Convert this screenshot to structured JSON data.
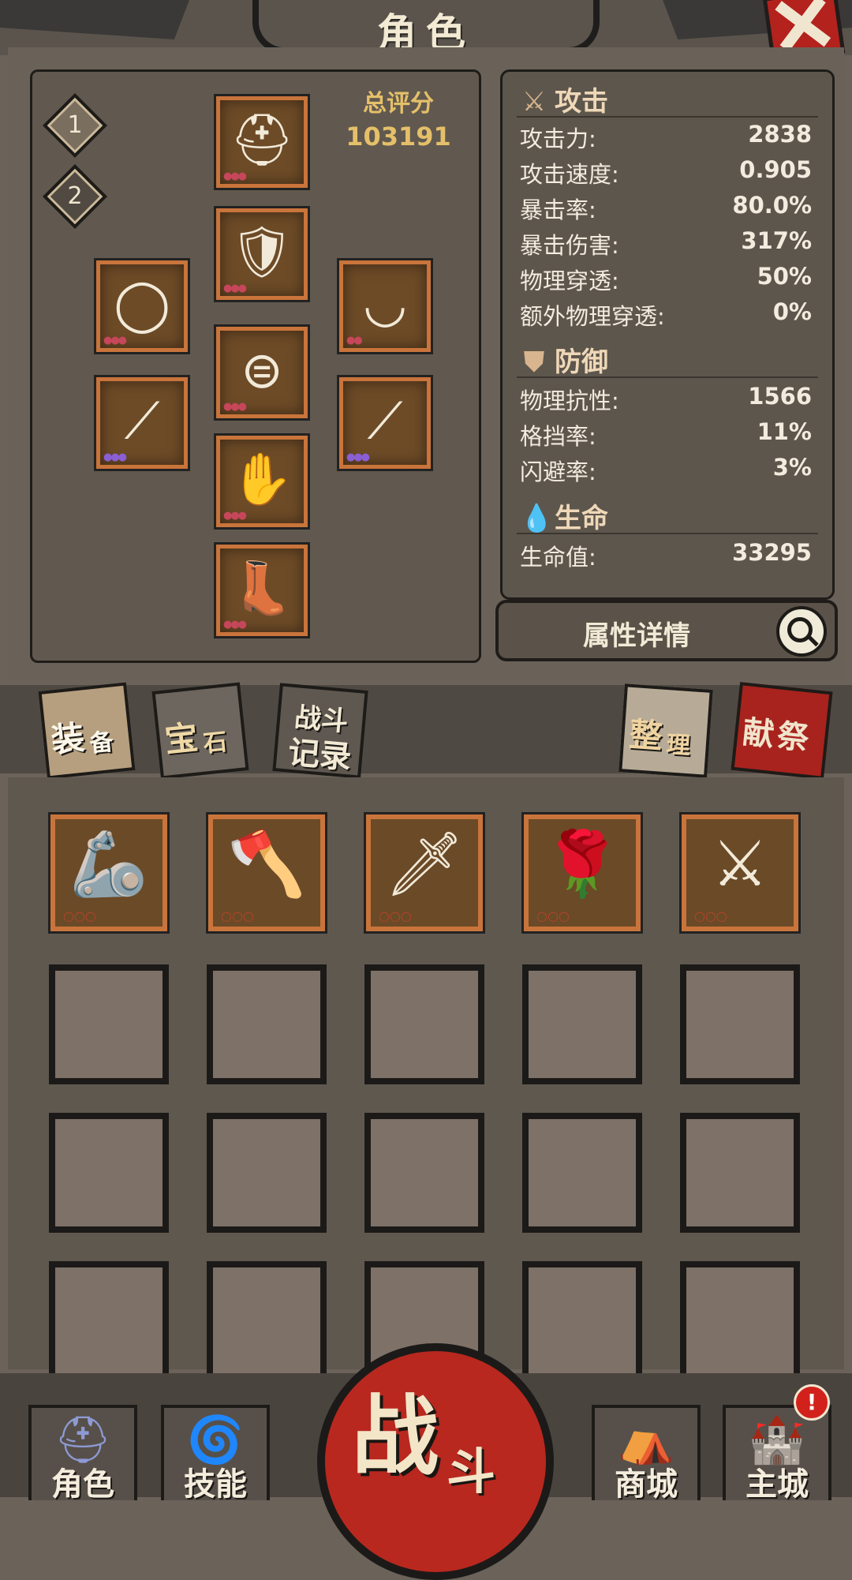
{
  "header": {
    "title": "角色"
  },
  "loadout": {
    "slot1": "1",
    "slot2": "2"
  },
  "score": {
    "label": "总评分",
    "value": "103191"
  },
  "equipment": [
    {
      "slot": "helmet",
      "icon": "helmet-icon"
    },
    {
      "slot": "armor",
      "icon": "chest-armor-icon"
    },
    {
      "slot": "ring",
      "icon": "ring-icon"
    },
    {
      "slot": "necklace",
      "icon": "claw-necklace-icon"
    },
    {
      "slot": "belt",
      "icon": "belt-icon"
    },
    {
      "slot": "weapon-left",
      "icon": "spear-icon"
    },
    {
      "slot": "weapon-right",
      "icon": "spear-icon"
    },
    {
      "slot": "gloves",
      "icon": "gauntlets-icon"
    },
    {
      "slot": "boots",
      "icon": "boots-icon"
    }
  ],
  "stats": {
    "attack_title": "攻击",
    "attack": [
      {
        "label": "攻击力:",
        "value": "2838"
      },
      {
        "label": "攻击速度:",
        "value": "0.905"
      },
      {
        "label": "暴击率:",
        "value": "80.0%"
      },
      {
        "label": "暴击伤害:",
        "value": "317%"
      },
      {
        "label": "物理穿透:",
        "value": "50%"
      },
      {
        "label": "额外物理穿透:",
        "value": "0%"
      }
    ],
    "defense_title": "防御",
    "defense": [
      {
        "label": "物理抗性:",
        "value": "1566"
      },
      {
        "label": "格挡率:",
        "value": "11%"
      },
      {
        "label": "闪避率:",
        "value": "3%"
      }
    ],
    "life_title": "生命",
    "life": [
      {
        "label": "生命值:",
        "value": "33295"
      }
    ]
  },
  "detail_button": "属性详情",
  "tabs": {
    "equip_a": "装",
    "equip_b": "备",
    "gem_a": "宝",
    "gem_b": "石",
    "log_a": "战斗",
    "log_b": "记录",
    "sort_a": "整",
    "sort_b": "理",
    "sac_a": "献",
    "sac_b": "祭"
  },
  "inventory_items": [
    {
      "icon": "claw-gauntlet-icon"
    },
    {
      "icon": "battle-axe-icon"
    },
    {
      "icon": "rapier-icon"
    },
    {
      "icon": "rose-sword-icon"
    },
    {
      "icon": "broadsword-icon"
    }
  ],
  "nav": {
    "role": "角色",
    "skill": "技能",
    "battle_a": "战",
    "battle_b": "斗",
    "shop": "商城",
    "city": "主城",
    "city_badge": "!"
  },
  "colors": {
    "accent_red": "#b8281f",
    "gold_text": "#e5c06a",
    "slot_border": "#c9743b"
  }
}
